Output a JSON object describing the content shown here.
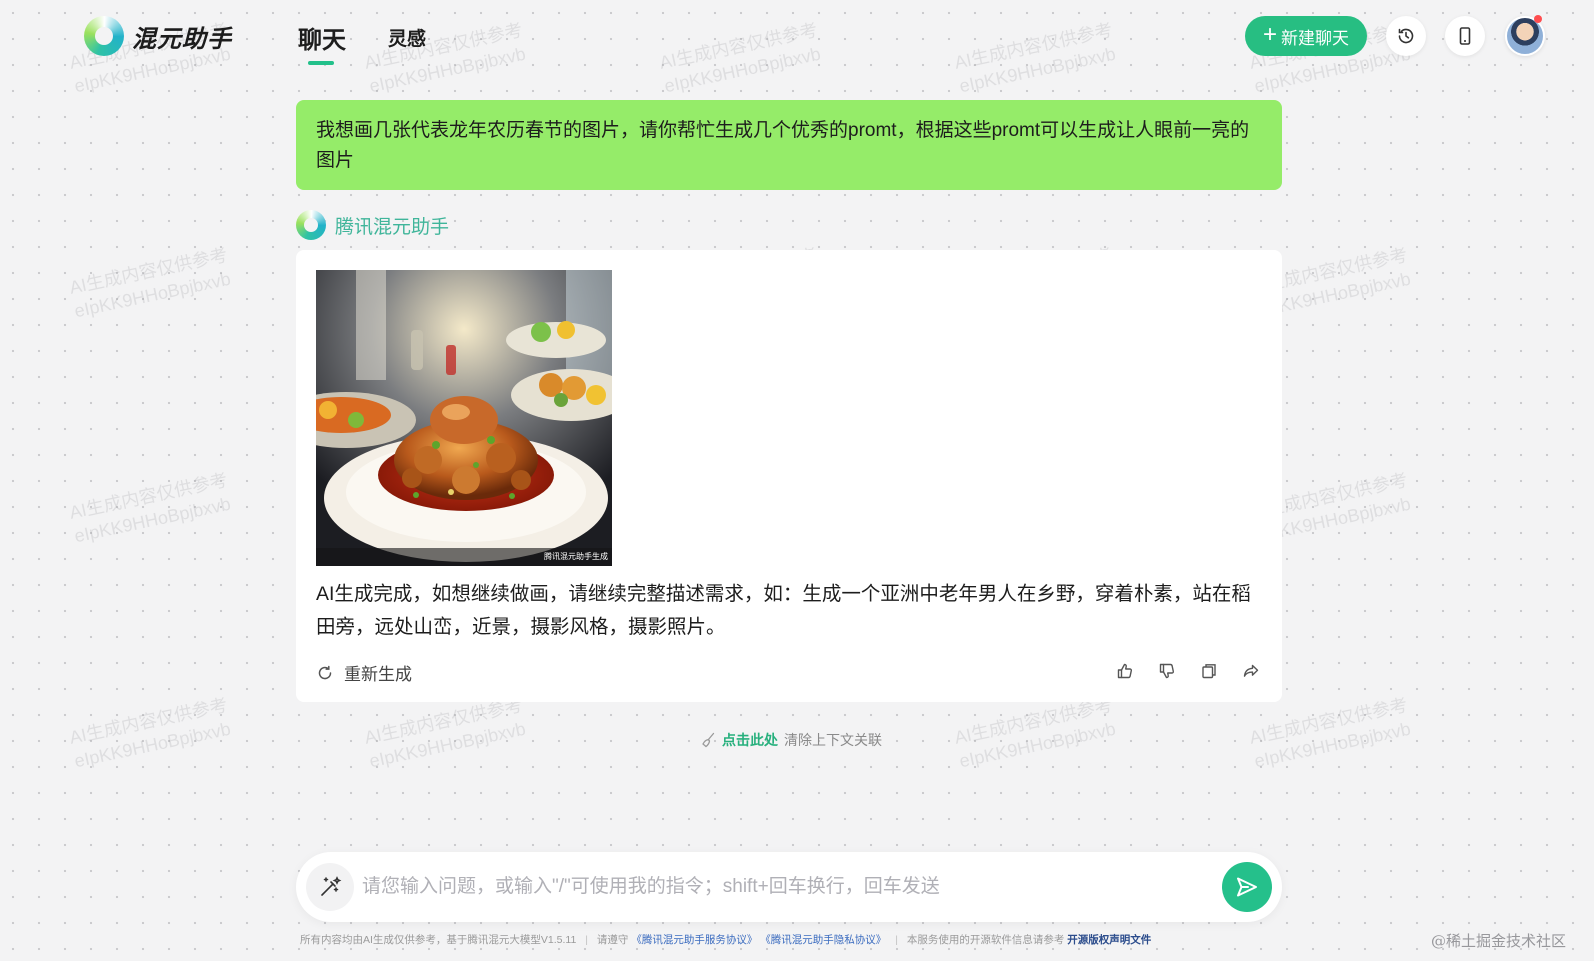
{
  "header": {
    "app_name": "混元助手",
    "tabs": [
      {
        "label": "聊天",
        "active": true
      },
      {
        "label": "灵感",
        "active": false
      }
    ],
    "new_chat_label": "新建聊天",
    "accent_color": "#27be82"
  },
  "watermark": {
    "line1": "AI生成内容仅供参考",
    "line2": "eIpKK9HHoBpjbxvb"
  },
  "conversation": {
    "user_message": "我想画几张代表龙年农历春节的图片，请你帮忙生成几个优秀的promt，根据这些promt可以生成让人眼前一亮的图片",
    "assistant": {
      "name": "腾讯混元助手",
      "image_caption": "腾讯混元助手生成",
      "text": "AI生成完成，如想继续做画，请继续完整描述需求，如：生成一个亚洲中老年男人在乡野，穿着朴素，站在稻田旁，远处山峦，近景，摄影风格，摄影照片。",
      "regenerate_label": "重新生成"
    },
    "clear_context": {
      "link_label": "点击此处",
      "text": "清除上下文关联"
    }
  },
  "input": {
    "placeholder": "请您输入问题，或输入\"/\"可使用我的指令；shift+回车换行，回车发送",
    "value": ""
  },
  "footer": {
    "disclaimer": "所有内容均由AI生成仅供参考，基于腾讯混元大模型V1.5.11",
    "agree_prefix": "请遵守",
    "service_agreement": "《腾讯混元助手服务协议》",
    "privacy_policy": "《腾讯混元助手隐私协议》",
    "oss_prefix": "本服务使用的开源软件信息请参考",
    "oss_link": "开源版权声明文件"
  },
  "credit": "@稀土掘金技术社区",
  "icons": [
    "history-icon",
    "mobile-icon",
    "refresh-icon",
    "thumbs-up-icon",
    "thumbs-down-icon",
    "copy-icon",
    "share-icon",
    "broom-icon",
    "magic-wand-icon",
    "send-icon"
  ]
}
